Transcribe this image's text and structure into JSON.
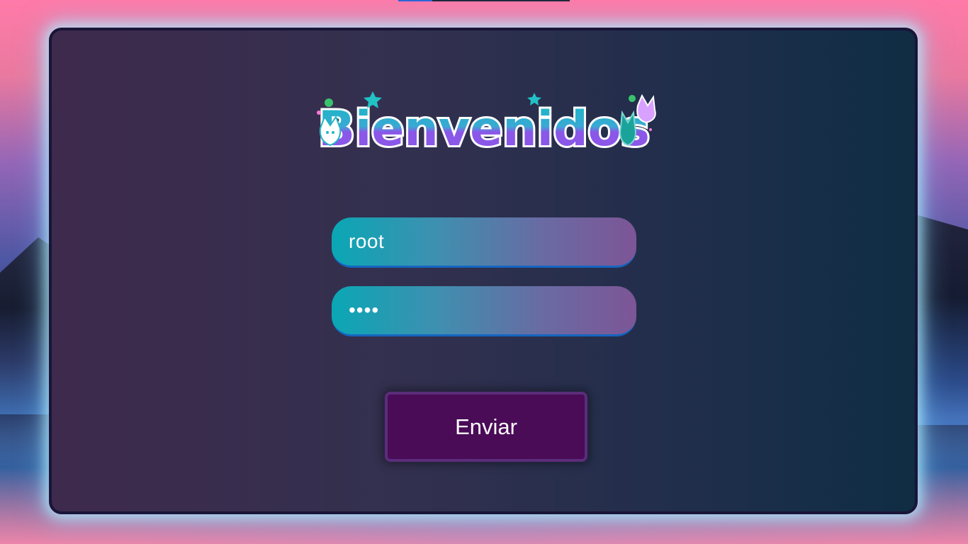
{
  "logo": {
    "text": "Bienvenidos",
    "colors": {
      "outline": "#ffffff",
      "fill_top": "#18b8c4",
      "fill_bottom": "#8a57e8",
      "star": "#22c1c5"
    }
  },
  "form": {
    "username_value": "root",
    "password_mask": "••••",
    "submit_label": "Enviar"
  },
  "colors": {
    "panel_border": "#191538",
    "button_bg": "#4a0b57",
    "button_border": "#5b2d7a",
    "input_border": "#1565c0"
  }
}
